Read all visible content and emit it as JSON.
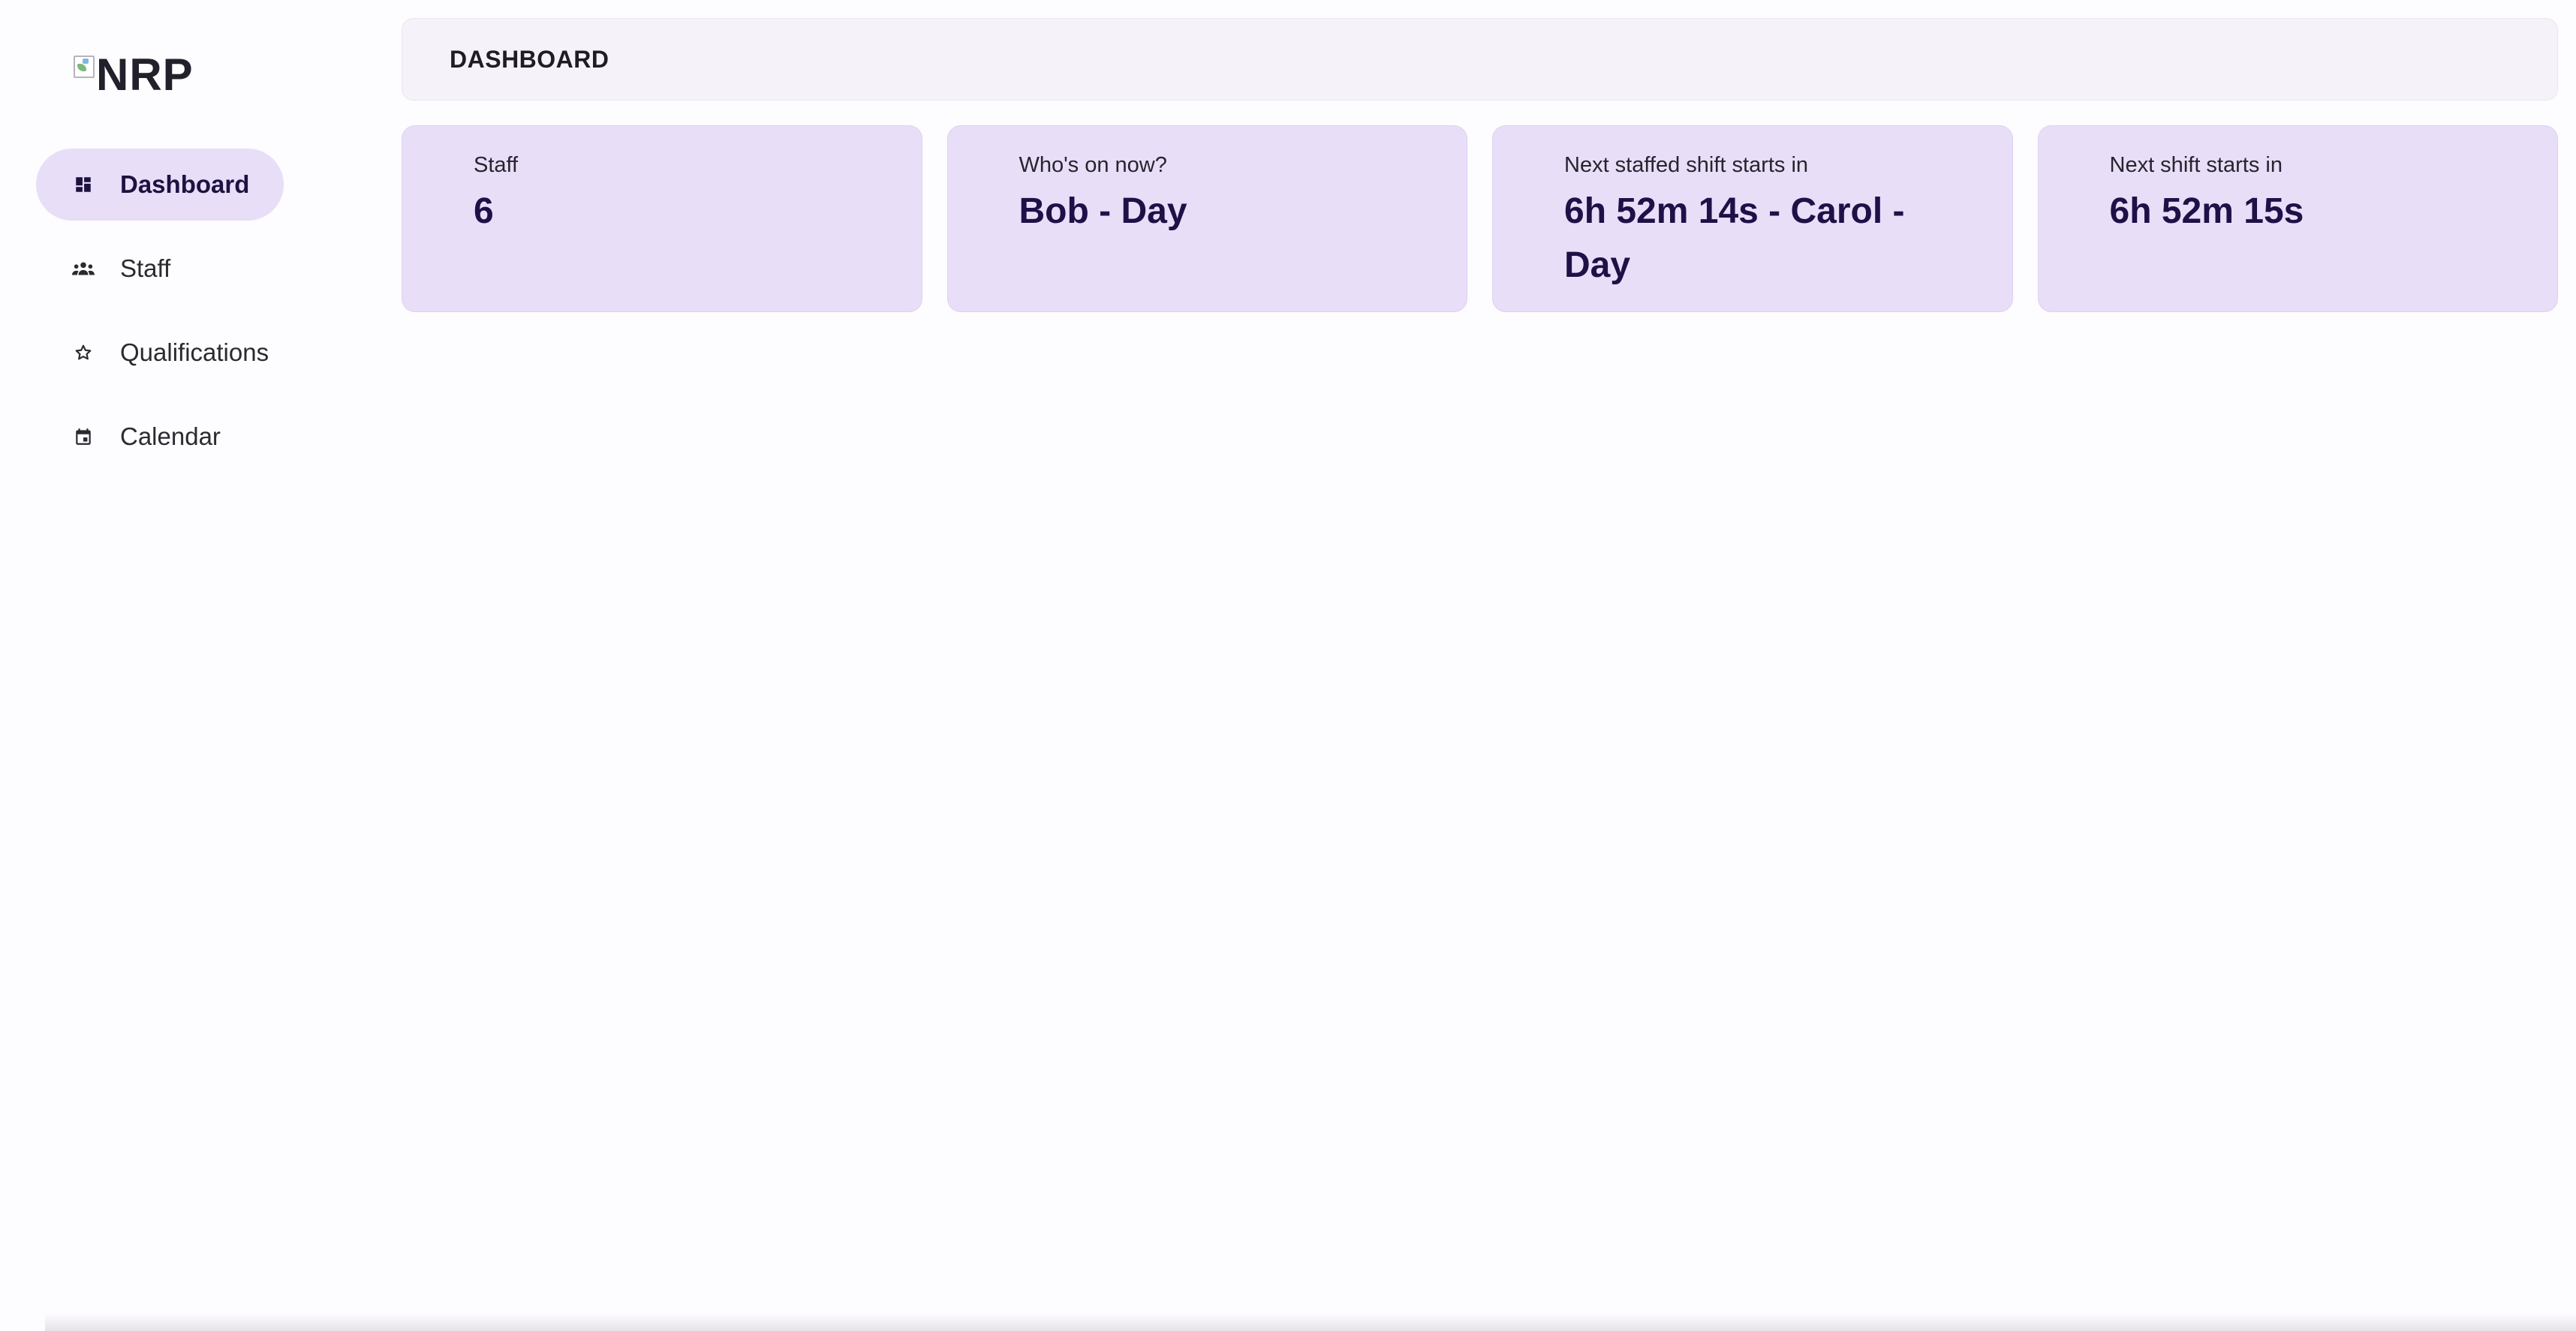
{
  "logo": {
    "alt_text": "NRP"
  },
  "sidebar": {
    "items": [
      {
        "label": "Dashboard",
        "icon": "dashboard-icon",
        "active": true
      },
      {
        "label": "Staff",
        "icon": "groups-icon",
        "active": false
      },
      {
        "label": "Qualifications",
        "icon": "star-icon",
        "active": false
      },
      {
        "label": "Calendar",
        "icon": "calendar-icon",
        "active": false
      }
    ]
  },
  "header": {
    "title": "DASHBOARD"
  },
  "cards": [
    {
      "label": "Staff",
      "value": "6"
    },
    {
      "label": "Who's on now?",
      "value": "Bob - Day"
    },
    {
      "label": "Next staffed shift starts in",
      "value": "6h 52m 14s - Carol - Day"
    },
    {
      "label": "Next shift starts in",
      "value": "6h 52m 15s"
    }
  ],
  "colors": {
    "accent_container": "#e8def8",
    "on_accent": "#1f1147",
    "background": "#fdfcfe",
    "topbar": "#f5f2f9"
  }
}
